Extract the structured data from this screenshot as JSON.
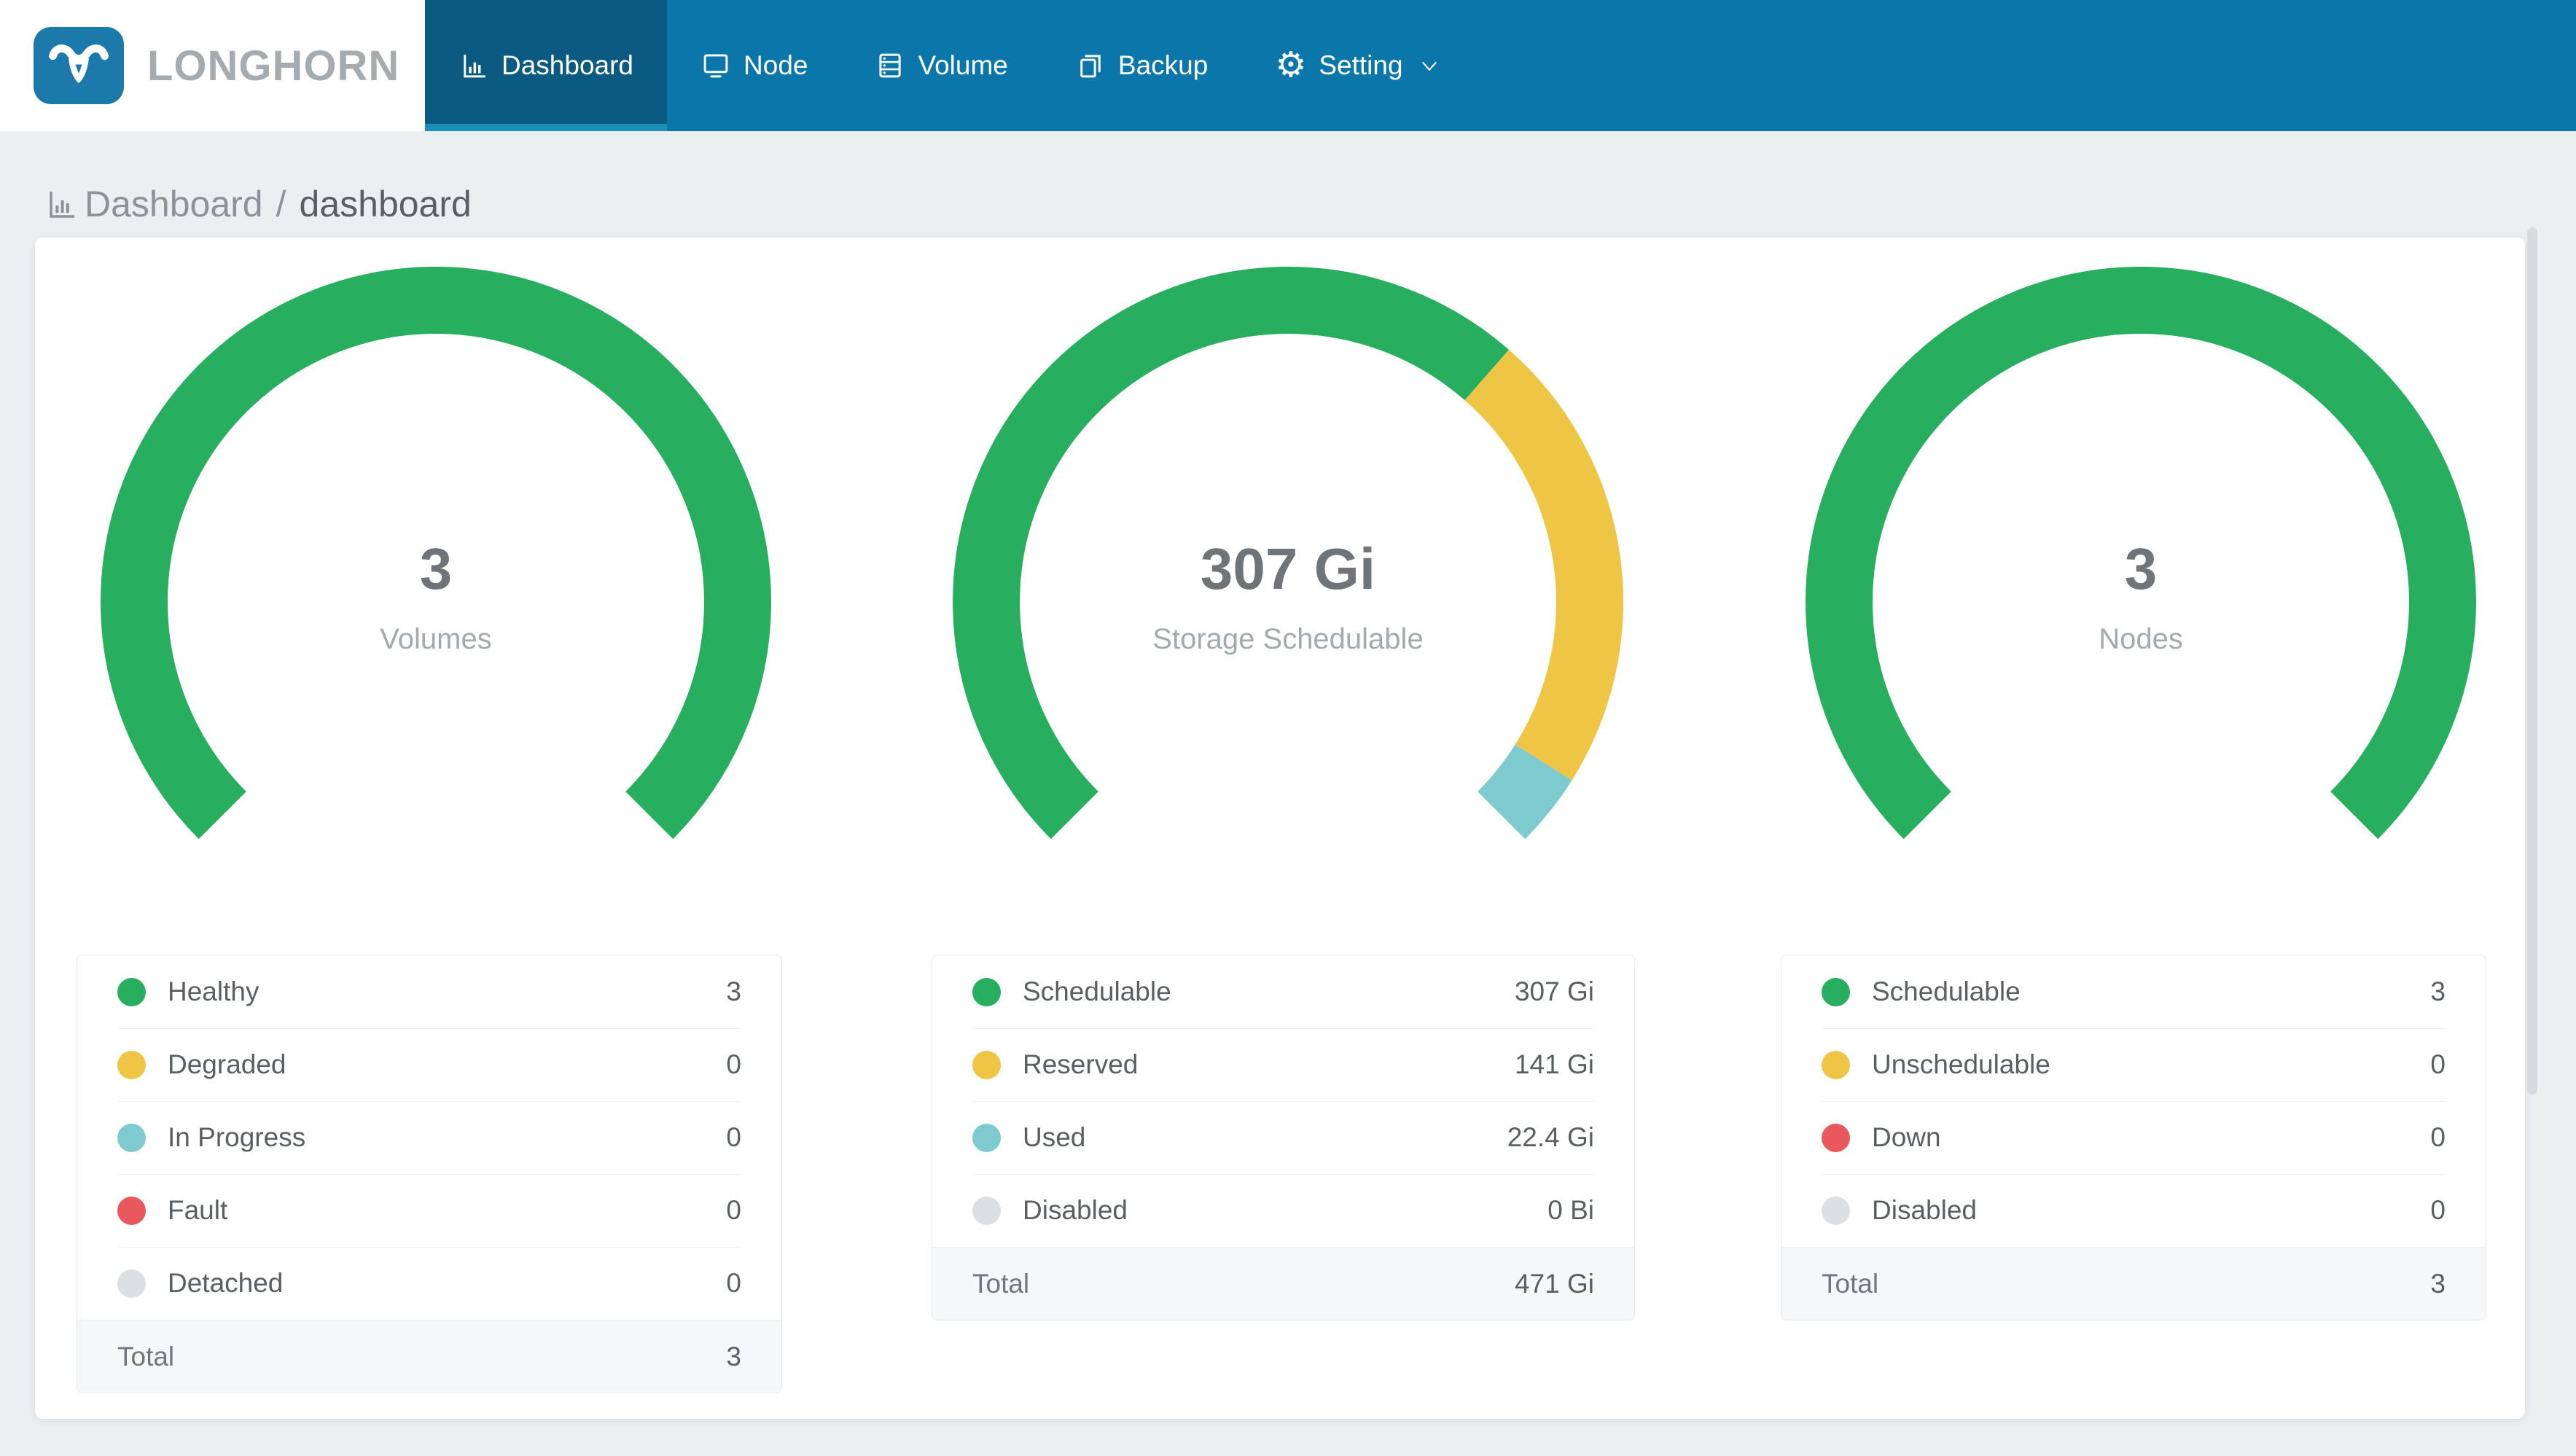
{
  "brand": {
    "logo_text": "LONGHORN",
    "logo_icon": "longhorn-bull-icon"
  },
  "nav": {
    "items": [
      {
        "label": "Dashboard",
        "icon": "bar-chart-icon",
        "active": true
      },
      {
        "label": "Node",
        "icon": "node-icon",
        "active": false
      },
      {
        "label": "Volume",
        "icon": "volume-icon",
        "active": false
      },
      {
        "label": "Backup",
        "icon": "backup-icon",
        "active": false
      },
      {
        "label": "Setting",
        "icon": "gear-icon",
        "active": false,
        "has_dropdown": true
      }
    ]
  },
  "icons": {
    "gear_glyph": "⚙"
  },
  "breadcrumb": {
    "icon": "bar-chart-icon",
    "section": "Dashboard",
    "separator": "/",
    "page": "dashboard"
  },
  "colors": {
    "navbar": "#0a76aa",
    "navbar_active": "#0a5a82",
    "navbar_active_strip": "#1b90bb",
    "logo_badge": "#1b7aa9",
    "page_bg": "#ebeff0",
    "card_bg": "#ffffff",
    "healthy_green": "#27ae5e",
    "warning_yellow": "#efc546",
    "progress_teal": "#7dcbce",
    "fault_red": "#e9585c",
    "disabled_gray": "#dde0e3"
  },
  "chart_data": [
    {
      "type": "gauge-donut",
      "arc": {
        "start_angle_deg": 225,
        "sweep_deg": 270,
        "direction": "clockwise"
      },
      "center_value": "3",
      "center_label": "Volumes",
      "segments": [
        {
          "name": "Healthy",
          "value": 3,
          "display": "3",
          "color": "#27ae5e"
        },
        {
          "name": "Degraded",
          "value": 0,
          "display": "0",
          "color": "#efc546"
        },
        {
          "name": "In Progress",
          "value": 0,
          "display": "0",
          "color": "#7dcbce"
        },
        {
          "name": "Fault",
          "value": 0,
          "display": "0",
          "color": "#e9585c"
        },
        {
          "name": "Detached",
          "value": 0,
          "display": "0",
          "color": "#dde0e3"
        }
      ],
      "total": {
        "label": "Total",
        "value": 3,
        "display": "3"
      }
    },
    {
      "type": "gauge-donut",
      "arc": {
        "start_angle_deg": 225,
        "sweep_deg": 270,
        "direction": "clockwise"
      },
      "center_value": "307 Gi",
      "center_label": "Storage Schedulable",
      "segments": [
        {
          "name": "Schedulable",
          "value": 307,
          "display": "307 Gi",
          "color": "#27ae5e"
        },
        {
          "name": "Reserved",
          "value": 141,
          "display": "141 Gi",
          "color": "#efc546"
        },
        {
          "name": "Used",
          "value": 22.4,
          "display": "22.4 Gi",
          "color": "#7dcbce"
        },
        {
          "name": "Disabled",
          "value": 0,
          "display": "0 Bi",
          "color": "#dde0e3"
        }
      ],
      "total": {
        "label": "Total",
        "value": 471,
        "display": "471 Gi"
      }
    },
    {
      "type": "gauge-donut",
      "arc": {
        "start_angle_deg": 225,
        "sweep_deg": 270,
        "direction": "clockwise"
      },
      "center_value": "3",
      "center_label": "Nodes",
      "segments": [
        {
          "name": "Schedulable",
          "value": 3,
          "display": "3",
          "color": "#27ae5e"
        },
        {
          "name": "Unschedulable",
          "value": 0,
          "display": "0",
          "color": "#efc546"
        },
        {
          "name": "Down",
          "value": 0,
          "display": "0",
          "color": "#e9585c"
        },
        {
          "name": "Disabled",
          "value": 0,
          "display": "0",
          "color": "#dde0e3"
        }
      ],
      "total": {
        "label": "Total",
        "value": 3,
        "display": "3"
      }
    }
  ]
}
